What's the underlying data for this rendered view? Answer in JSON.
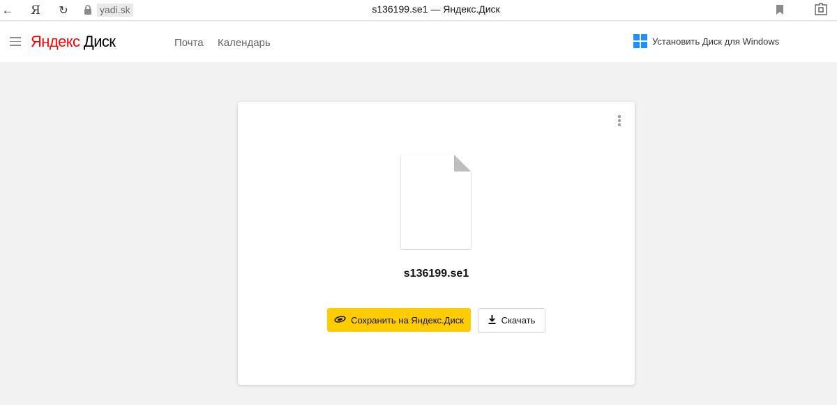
{
  "browser": {
    "url": "yadi.sk",
    "tab_title": "s136199.se1 — Яндекс.Диск",
    "yandex_button": "Я",
    "back_icon": "arrow-left-icon",
    "reload_icon": "reload-icon",
    "lock_icon": "lock-icon",
    "bookmark_icon": "bookmark-icon",
    "extension_icon": "extensions-icon"
  },
  "header": {
    "logo_brand": "Яндекс",
    "logo_product": "Диск",
    "links": [
      "Почта",
      "Календарь"
    ],
    "install_label": "Установить Диск для Windows",
    "install_icon": "windows-icon",
    "menu_icon": "hamburger-icon"
  },
  "file": {
    "name": "s136199.se1",
    "icon": "document-icon",
    "more_icon": "more-vertical-icon"
  },
  "actions": {
    "save_label": "Сохранить на Яндекс.Диск",
    "save_icon": "yandex-disk-icon",
    "download_label": "Скачать",
    "download_icon": "download-icon"
  },
  "colors": {
    "brand_red": "#ff0000",
    "save_button": "#ffcc00",
    "windows_blue": "#1e90ff",
    "page_background": "#f2f2f2"
  }
}
